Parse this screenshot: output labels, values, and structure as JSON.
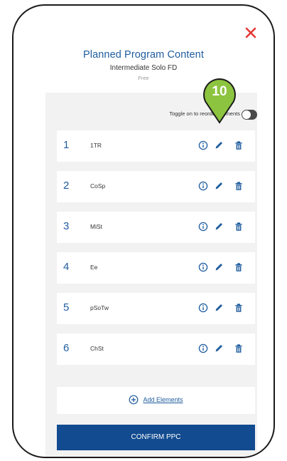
{
  "dialog": {
    "title": "Planned Program Content",
    "subtitle": "Intermediate Solo FD",
    "fee": "Free"
  },
  "toggle": {
    "label": "Toggle on to reorder elements",
    "state": "off"
  },
  "elements": [
    {
      "number": "1",
      "name": "1TR"
    },
    {
      "number": "2",
      "name": "CoSp"
    },
    {
      "number": "3",
      "name": "MiSt"
    },
    {
      "number": "4",
      "name": "Ee"
    },
    {
      "number": "5",
      "name": "pSoTw"
    },
    {
      "number": "6",
      "name": "ChSt"
    }
  ],
  "actions": {
    "add_elements": "Add Elements",
    "confirm": "CONFIRM PPC"
  },
  "step_badge": {
    "number": "10",
    "color": "#8cc43f"
  },
  "icons": {
    "close": "close-icon",
    "info": "info-icon",
    "edit": "pencil-icon",
    "delete": "trash-icon",
    "add": "plus-circle-icon"
  },
  "colors": {
    "accent": "#1f5c9e",
    "close": "#e53935",
    "confirm_bg": "#124b8f",
    "panel_bg": "#f2f2f2"
  }
}
